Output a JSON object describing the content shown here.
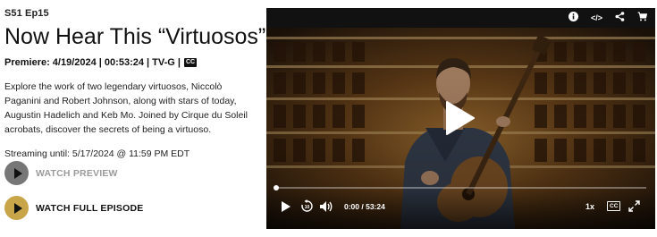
{
  "episode": {
    "code": "S51 Ep15",
    "title": "Now Hear This “Virtuosos”",
    "premiere": "Premiere: 4/19/2024 | 00:53:24 | TV-G |",
    "cc_badge": "CC",
    "description": "Explore the work of two legendary virtuosos, Niccolò Paganini and Robert Johnson, along with stars of today, Augustin Hadelich and Keb Mo. Joined by Cirque du Soleil acrobats, discover the secrets of being a virtuoso.",
    "streaming": "Streaming until: 5/17/2024 @ 11:59 PM EDT"
  },
  "actions": {
    "preview_label": "WATCH PREVIEW",
    "full_label": "WATCH FULL EPISODE"
  },
  "player": {
    "top_icons": {
      "info": "ⓘ",
      "embed": "</>",
      "share": "share",
      "cart": "cart"
    },
    "current_time": "0:00",
    "separator": "/",
    "duration": "53:24",
    "time_display": "0:00  /  53:24",
    "progress_fraction": 0.0,
    "speed": "1x",
    "cc_label": "CC"
  },
  "colors": {
    "accent_gold": "#c9a54a",
    "preview_gray": "#777777",
    "player_bg": "#0c0b0a"
  }
}
